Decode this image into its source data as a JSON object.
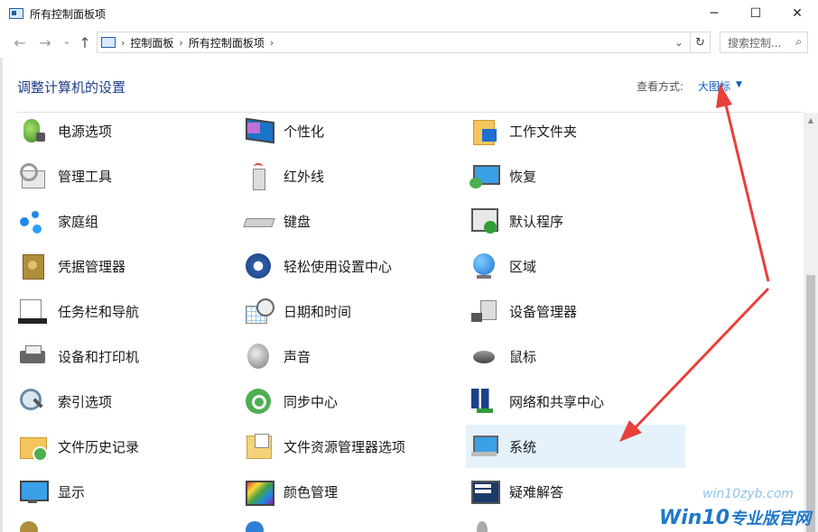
{
  "window": {
    "title": "所有控制面板项",
    "minimize": "─",
    "maximize": "☐",
    "close": "✕"
  },
  "nav": {
    "back": "←",
    "forward": "→",
    "recent": "⌄",
    "up": "↑"
  },
  "address": {
    "breadcrumbs": [
      "控制面板",
      "所有控制面板项"
    ],
    "separator": "›",
    "dropdown": "⌄",
    "refresh": "↻"
  },
  "search": {
    "placeholder": "搜索控制...",
    "icon": "⌕"
  },
  "header": {
    "title": "调整计算机的设置",
    "view_by_label": "查看方式:",
    "view_by_value": "大图标",
    "view_by_caret": "▼"
  },
  "columns": [
    [
      {
        "label": "电源选项",
        "icon": "power-options-icon"
      },
      {
        "label": "管理工具",
        "icon": "admin-tools-icon"
      },
      {
        "label": "家庭组",
        "icon": "homegroup-icon"
      },
      {
        "label": "凭据管理器",
        "icon": "credential-manager-icon"
      },
      {
        "label": "任务栏和导航",
        "icon": "taskbar-icon"
      },
      {
        "label": "设备和打印机",
        "icon": "printer-icon"
      },
      {
        "label": "索引选项",
        "icon": "indexing-icon"
      },
      {
        "label": "文件历史记录",
        "icon": "file-history-icon"
      },
      {
        "label": "显示",
        "icon": "display-icon"
      }
    ],
    [
      {
        "label": "个性化",
        "icon": "personalization-icon"
      },
      {
        "label": "红外线",
        "icon": "infrared-icon"
      },
      {
        "label": "键盘",
        "icon": "keyboard-icon"
      },
      {
        "label": "轻松使用设置中心",
        "icon": "ease-of-access-icon"
      },
      {
        "label": "日期和时间",
        "icon": "date-time-icon"
      },
      {
        "label": "声音",
        "icon": "sound-icon"
      },
      {
        "label": "同步中心",
        "icon": "sync-center-icon"
      },
      {
        "label": "文件资源管理器选项",
        "icon": "explorer-options-icon"
      },
      {
        "label": "颜色管理",
        "icon": "color-management-icon"
      }
    ],
    [
      {
        "label": "工作文件夹",
        "icon": "work-folders-icon"
      },
      {
        "label": "恢复",
        "icon": "recovery-icon"
      },
      {
        "label": "默认程序",
        "icon": "default-programs-icon"
      },
      {
        "label": "区域",
        "icon": "region-icon"
      },
      {
        "label": "设备管理器",
        "icon": "device-manager-icon"
      },
      {
        "label": "鼠标",
        "icon": "mouse-icon"
      },
      {
        "label": "网络和共享中心",
        "icon": "network-icon"
      },
      {
        "label": "系统",
        "icon": "system-icon"
      },
      {
        "label": "疑难解答",
        "icon": "troubleshooting-icon"
      }
    ]
  ],
  "highlighted_item": "系统",
  "watermark": {
    "line1": "win10zyb.com",
    "line2_brand": "Win10",
    "line2_text": "专业版官网"
  },
  "colors": {
    "accent": "#0c5bbf",
    "header_title": "#1e3f8a",
    "highlight_bg": "#e5f1fb",
    "annotation_arrow": "#e8403a"
  }
}
